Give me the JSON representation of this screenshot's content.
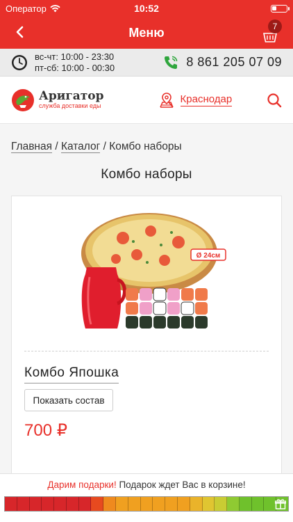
{
  "status_bar": {
    "carrier": "Оператор",
    "time": "10:52"
  },
  "header": {
    "title": "Меню",
    "cart_count": "7"
  },
  "info": {
    "hours_line1": "вс-чт: 10:00 - 23:30",
    "hours_line2": "пт-сб: 10:00 - 00:30",
    "phone": "8 861 205 07 09"
  },
  "brand": {
    "name": "Аригатор",
    "slogan": "служба доставки еды",
    "city": "Краснодар"
  },
  "breadcrumb": {
    "home": "Главная",
    "catalog": "Каталог",
    "current": "Комбо наборы",
    "separator": "/"
  },
  "page": {
    "title": "Комбо наборы"
  },
  "product": {
    "name": "Комбо Япошка",
    "show_button": "Показать состав",
    "price": "700 ₽",
    "size_badge": "Ø 24см"
  },
  "gift": {
    "highlight": "Дарим подарки!",
    "text": "Подарок ждет Вас в корзине!",
    "segment_colors": [
      "#d7262a",
      "#d7262a",
      "#d7262a",
      "#d7262a",
      "#d7262a",
      "#d7262a",
      "#d7262a",
      "#e74a1f",
      "#ef8a1e",
      "#f0a020",
      "#f0a020",
      "#f0a020",
      "#f0a020",
      "#f0a020",
      "#f0a020",
      "#eab32a",
      "#e0c531",
      "#c9cc33",
      "#8fca32",
      "#6fc12c",
      "#6fc12c",
      "#6fc12c",
      "#6fc12c"
    ]
  },
  "colors": {
    "brand_red": "#e8302a"
  }
}
